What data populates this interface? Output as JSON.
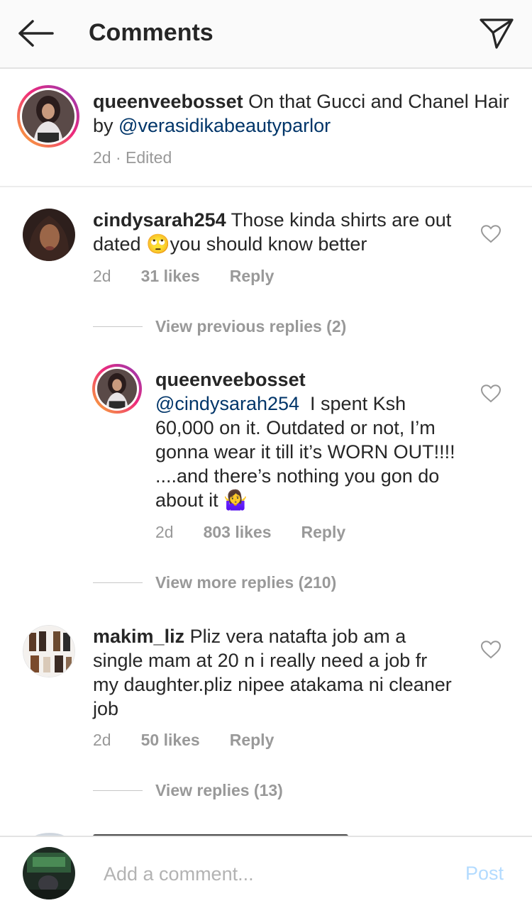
{
  "header": {
    "title": "Comments"
  },
  "caption": {
    "username": "queenveebosset",
    "text_before": " On that Gucci and Chanel Hair by ",
    "mention": "@verasidikabeautyparlor",
    "time": "2d",
    "separator": " · ",
    "edited": "Edited"
  },
  "comments": [
    {
      "username": "cindysarah254",
      "text": " Those kinda shirts are out dated 🙄you should know better",
      "time": "2d",
      "likes": "31 likes",
      "reply": "Reply",
      "view_replies": "View previous replies (2)"
    },
    {
      "username": "queenveebosset",
      "mention": "@cindysarah254",
      "text": "  I spent Ksh 60,000 on it. Outdated or not, I’m gonna wear it till it’s WORN OUT!!!! ....and there’s nothing you gon do about it 🤷‍♀",
      "time": "2d",
      "likes": "803 likes",
      "reply": "Reply",
      "view_replies": "View more replies (210)"
    },
    {
      "username": "makim_liz",
      "text": " Pliz vera natafta job am a single mam at 20 n i really need a job fr my daughter.pliz nipee atakama ni cleaner job",
      "time": "2d",
      "likes": "50 likes",
      "reply": "Reply",
      "view_replies": "View replies (13)"
    }
  ],
  "composer": {
    "placeholder": "Add a comment...",
    "post_label": "Post"
  },
  "colors": {
    "mention": "#003569",
    "muted": "#999999",
    "post_disabled": "#b3dbff"
  }
}
